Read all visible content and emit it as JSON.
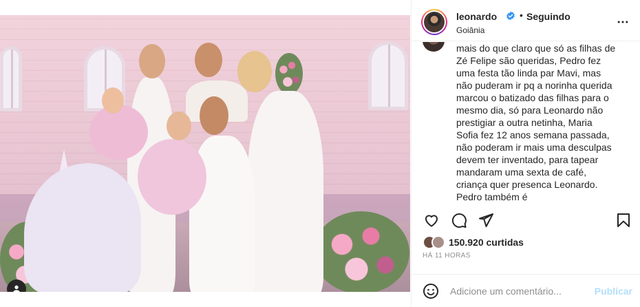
{
  "post": {
    "owner": {
      "username": "leonardo",
      "verified_icon": "verified-badge-icon",
      "separator": "•",
      "follow_status": "Seguindo",
      "location": "Goiânia"
    },
    "more_icon": "more-options-icon",
    "comment": {
      "text": "mais do que claro que só as filhas de Zé Felipe são queridas, Pedro fez uma festa tão linda par Mavi, mas não puderam ir pq a norinha querida marcou o batizado das filhas para o mesmo dia, só para Leonardo não prestigiar a outra netinha, Maria Sofia fez 12 anos semana passada, não poderam ir mais uma desculpas devem ter inventado, para tapear mandaram uma sexta de café, criança quer presenca Leonardo. Pedro também é"
    },
    "actions": {
      "like_icon": "heart-icon",
      "comment_icon": "comment-bubble-icon",
      "share_icon": "paper-plane-icon",
      "save_icon": "bookmark-icon"
    },
    "likes": {
      "count": "150.920",
      "label": "curtidas"
    },
    "time_ago": "HÁ 11 HORAS",
    "add_comment": {
      "placeholder": "Adicione um comentário...",
      "publish_label": "Publicar",
      "emoji_icon": "emoji-smile-icon"
    },
    "photo": {
      "tag_icon": "user-tag-icon"
    }
  },
  "colors": {
    "text": "#262626",
    "muted": "#8e8e8e",
    "verified": "#3897f0",
    "publish_disabled": "#b2dffc",
    "border": "#efefef"
  }
}
